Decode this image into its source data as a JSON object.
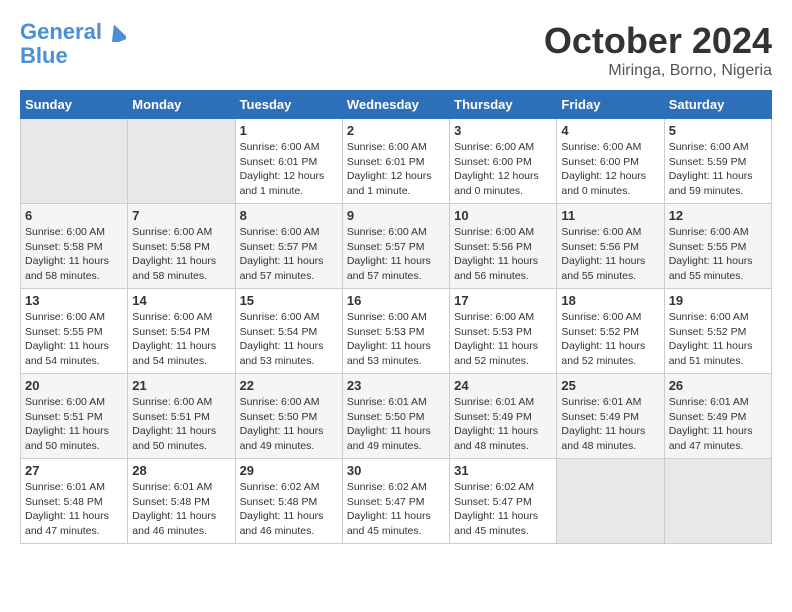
{
  "header": {
    "logo_line1": "General",
    "logo_line2": "Blue",
    "title": "October 2024",
    "location": "Miringa, Borno, Nigeria"
  },
  "weekdays": [
    "Sunday",
    "Monday",
    "Tuesday",
    "Wednesday",
    "Thursday",
    "Friday",
    "Saturday"
  ],
  "weeks": [
    [
      {
        "day": "",
        "content": ""
      },
      {
        "day": "",
        "content": ""
      },
      {
        "day": "1",
        "content": "Sunrise: 6:00 AM\nSunset: 6:01 PM\nDaylight: 12 hours\nand 1 minute."
      },
      {
        "day": "2",
        "content": "Sunrise: 6:00 AM\nSunset: 6:01 PM\nDaylight: 12 hours\nand 1 minute."
      },
      {
        "day": "3",
        "content": "Sunrise: 6:00 AM\nSunset: 6:00 PM\nDaylight: 12 hours\nand 0 minutes."
      },
      {
        "day": "4",
        "content": "Sunrise: 6:00 AM\nSunset: 6:00 PM\nDaylight: 12 hours\nand 0 minutes."
      },
      {
        "day": "5",
        "content": "Sunrise: 6:00 AM\nSunset: 5:59 PM\nDaylight: 11 hours\nand 59 minutes."
      }
    ],
    [
      {
        "day": "6",
        "content": "Sunrise: 6:00 AM\nSunset: 5:58 PM\nDaylight: 11 hours\nand 58 minutes."
      },
      {
        "day": "7",
        "content": "Sunrise: 6:00 AM\nSunset: 5:58 PM\nDaylight: 11 hours\nand 58 minutes."
      },
      {
        "day": "8",
        "content": "Sunrise: 6:00 AM\nSunset: 5:57 PM\nDaylight: 11 hours\nand 57 minutes."
      },
      {
        "day": "9",
        "content": "Sunrise: 6:00 AM\nSunset: 5:57 PM\nDaylight: 11 hours\nand 57 minutes."
      },
      {
        "day": "10",
        "content": "Sunrise: 6:00 AM\nSunset: 5:56 PM\nDaylight: 11 hours\nand 56 minutes."
      },
      {
        "day": "11",
        "content": "Sunrise: 6:00 AM\nSunset: 5:56 PM\nDaylight: 11 hours\nand 55 minutes."
      },
      {
        "day": "12",
        "content": "Sunrise: 6:00 AM\nSunset: 5:55 PM\nDaylight: 11 hours\nand 55 minutes."
      }
    ],
    [
      {
        "day": "13",
        "content": "Sunrise: 6:00 AM\nSunset: 5:55 PM\nDaylight: 11 hours\nand 54 minutes."
      },
      {
        "day": "14",
        "content": "Sunrise: 6:00 AM\nSunset: 5:54 PM\nDaylight: 11 hours\nand 54 minutes."
      },
      {
        "day": "15",
        "content": "Sunrise: 6:00 AM\nSunset: 5:54 PM\nDaylight: 11 hours\nand 53 minutes."
      },
      {
        "day": "16",
        "content": "Sunrise: 6:00 AM\nSunset: 5:53 PM\nDaylight: 11 hours\nand 53 minutes."
      },
      {
        "day": "17",
        "content": "Sunrise: 6:00 AM\nSunset: 5:53 PM\nDaylight: 11 hours\nand 52 minutes."
      },
      {
        "day": "18",
        "content": "Sunrise: 6:00 AM\nSunset: 5:52 PM\nDaylight: 11 hours\nand 52 minutes."
      },
      {
        "day": "19",
        "content": "Sunrise: 6:00 AM\nSunset: 5:52 PM\nDaylight: 11 hours\nand 51 minutes."
      }
    ],
    [
      {
        "day": "20",
        "content": "Sunrise: 6:00 AM\nSunset: 5:51 PM\nDaylight: 11 hours\nand 50 minutes."
      },
      {
        "day": "21",
        "content": "Sunrise: 6:00 AM\nSunset: 5:51 PM\nDaylight: 11 hours\nand 50 minutes."
      },
      {
        "day": "22",
        "content": "Sunrise: 6:00 AM\nSunset: 5:50 PM\nDaylight: 11 hours\nand 49 minutes."
      },
      {
        "day": "23",
        "content": "Sunrise: 6:01 AM\nSunset: 5:50 PM\nDaylight: 11 hours\nand 49 minutes."
      },
      {
        "day": "24",
        "content": "Sunrise: 6:01 AM\nSunset: 5:49 PM\nDaylight: 11 hours\nand 48 minutes."
      },
      {
        "day": "25",
        "content": "Sunrise: 6:01 AM\nSunset: 5:49 PM\nDaylight: 11 hours\nand 48 minutes."
      },
      {
        "day": "26",
        "content": "Sunrise: 6:01 AM\nSunset: 5:49 PM\nDaylight: 11 hours\nand 47 minutes."
      }
    ],
    [
      {
        "day": "27",
        "content": "Sunrise: 6:01 AM\nSunset: 5:48 PM\nDaylight: 11 hours\nand 47 minutes."
      },
      {
        "day": "28",
        "content": "Sunrise: 6:01 AM\nSunset: 5:48 PM\nDaylight: 11 hours\nand 46 minutes."
      },
      {
        "day": "29",
        "content": "Sunrise: 6:02 AM\nSunset: 5:48 PM\nDaylight: 11 hours\nand 46 minutes."
      },
      {
        "day": "30",
        "content": "Sunrise: 6:02 AM\nSunset: 5:47 PM\nDaylight: 11 hours\nand 45 minutes."
      },
      {
        "day": "31",
        "content": "Sunrise: 6:02 AM\nSunset: 5:47 PM\nDaylight: 11 hours\nand 45 minutes."
      },
      {
        "day": "",
        "content": ""
      },
      {
        "day": "",
        "content": ""
      }
    ]
  ]
}
